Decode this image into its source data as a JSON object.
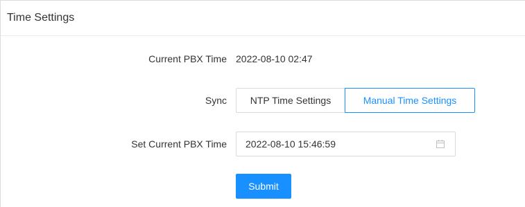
{
  "panel": {
    "title": "Time Settings"
  },
  "current_time": {
    "label": "Current PBX Time",
    "value": "2022-08-10 02:47"
  },
  "sync": {
    "label": "Sync",
    "options": [
      {
        "label": "NTP Time Settings",
        "selected": false
      },
      {
        "label": "Manual Time Settings",
        "selected": true
      }
    ]
  },
  "set_time": {
    "label": "Set Current PBX Time",
    "value": "2022-08-10 15:46:59",
    "icon": "calendar-icon"
  },
  "submit": {
    "label": "Submit"
  },
  "colors": {
    "accent": "#1890ff",
    "border": "#d9d9d9",
    "text": "#333333"
  }
}
